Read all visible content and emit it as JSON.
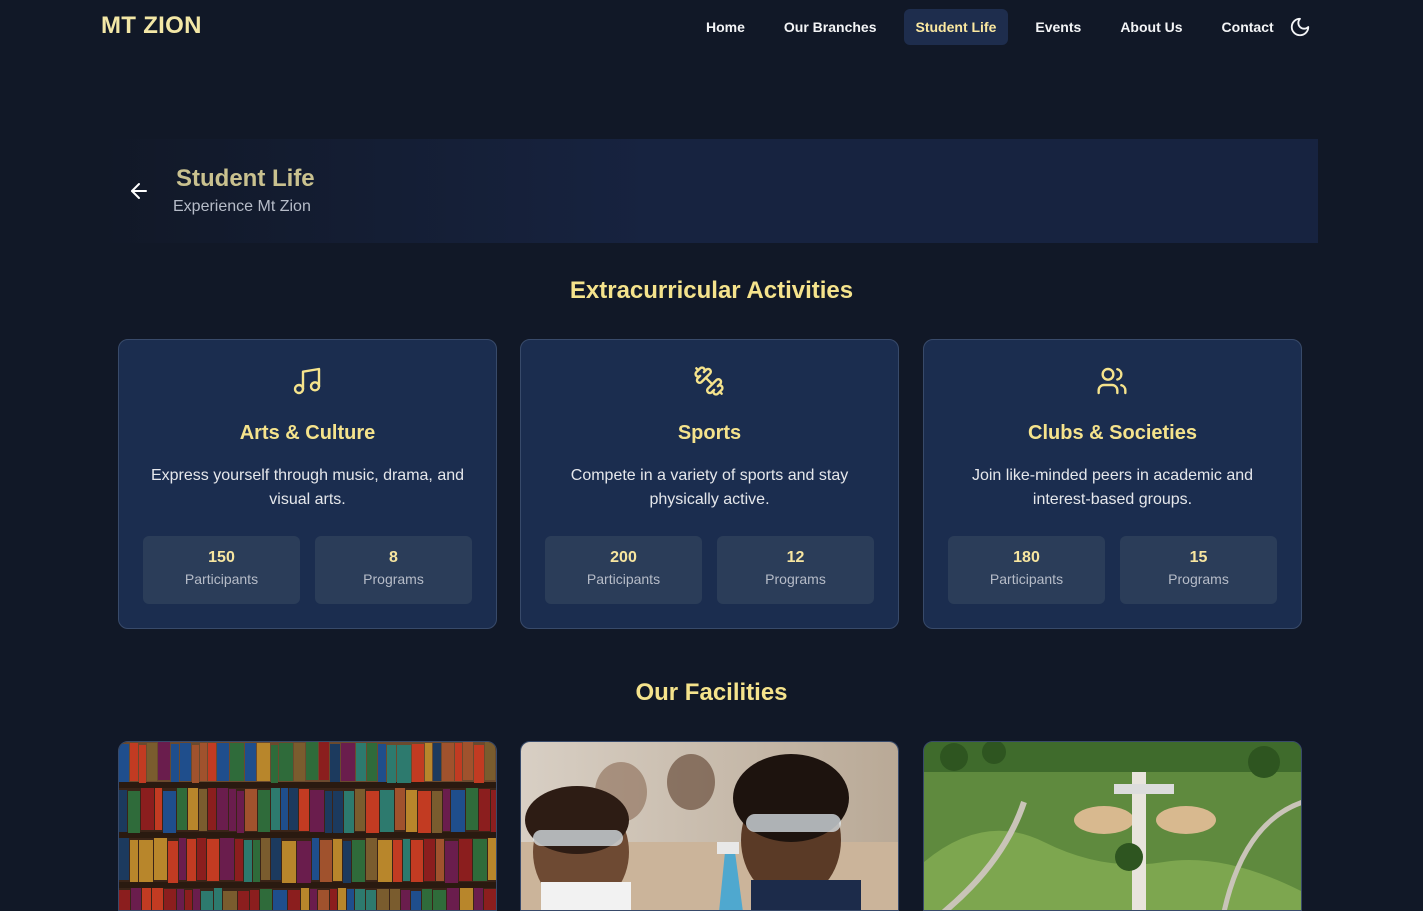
{
  "brand": "MT ZION",
  "nav": {
    "items": [
      {
        "label": "Home",
        "active": false
      },
      {
        "label": "Our Branches",
        "active": false
      },
      {
        "label": "Student Life",
        "active": true
      },
      {
        "label": "Events",
        "active": false
      },
      {
        "label": "About Us",
        "active": false
      },
      {
        "label": "Contact",
        "active": false
      }
    ],
    "theme_icon": "moon-icon"
  },
  "hero": {
    "title": "Student Life",
    "subtitle": "Experience Mt Zion",
    "back_icon": "arrow-left-icon"
  },
  "activities": {
    "title": "Extracurricular Activities",
    "cards": [
      {
        "icon": "music-icon",
        "title": "Arts & Culture",
        "description": "Express yourself through music, drama, and visual arts.",
        "participants": "150",
        "participants_label": "Participants",
        "programs": "8",
        "programs_label": "Programs"
      },
      {
        "icon": "dumbbell-icon",
        "title": "Sports",
        "description": "Compete in a variety of sports and stay physically active.",
        "participants": "200",
        "participants_label": "Participants",
        "programs": "12",
        "programs_label": "Programs"
      },
      {
        "icon": "users-icon",
        "title": "Clubs & Societies",
        "description": "Join like-minded peers in academic and interest-based groups.",
        "participants": "180",
        "participants_label": "Participants",
        "programs": "15",
        "programs_label": "Programs"
      }
    ]
  },
  "facilities": {
    "title": "Our Facilities"
  },
  "colors": {
    "background": "#111827",
    "accent": "#f5e38c",
    "card": "#1b2d4f",
    "stat": "#2b3d59"
  }
}
